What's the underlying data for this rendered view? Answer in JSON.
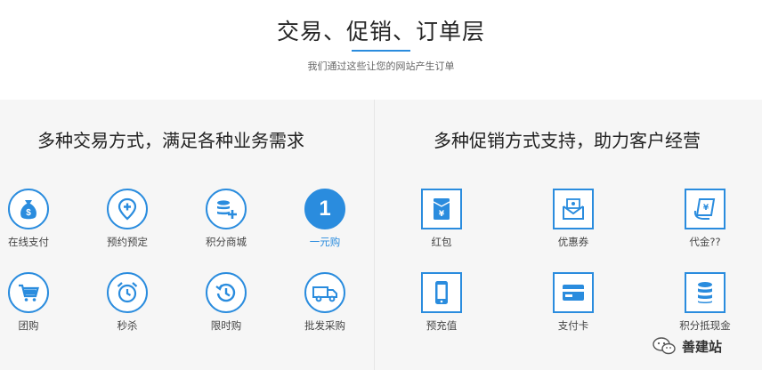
{
  "header": {
    "title": "交易、促销、订单层",
    "subtitle": "我们通过这些让您的网站产生订单",
    "accent_color": "#2a8cde"
  },
  "left_panel": {
    "title": "多种交易方式，满足各种业务需求",
    "items": [
      {
        "label": "在线支付",
        "icon": "money-bag-icon"
      },
      {
        "label": "预约预定",
        "icon": "location-plus-icon"
      },
      {
        "label": "积分商城",
        "icon": "coin-stack-plus-icon"
      },
      {
        "label": "一元购",
        "icon": "number-one-icon",
        "number": "1",
        "active": true
      },
      {
        "label": "团购",
        "icon": "shopping-cart-icon"
      },
      {
        "label": "秒杀",
        "icon": "alarm-clock-icon"
      },
      {
        "label": "限时购",
        "icon": "history-clock-icon"
      },
      {
        "label": "批发采购",
        "icon": "truck-icon"
      }
    ]
  },
  "right_panel": {
    "title": "多种促销方式支持，助力客户经营",
    "items": [
      {
        "label": "红包",
        "icon": "red-envelope-icon"
      },
      {
        "label": "优惠券",
        "icon": "coupon-envelope-icon"
      },
      {
        "label": "代金??",
        "icon": "voucher-icon"
      },
      {
        "label": "预充值",
        "icon": "mobile-phone-icon"
      },
      {
        "label": "支付卡",
        "icon": "payment-card-icon"
      },
      {
        "label": "积分抵现金",
        "icon": "coin-stack-icon"
      }
    ]
  },
  "watermark": {
    "text": "善建站",
    "icon": "wechat-icon"
  }
}
